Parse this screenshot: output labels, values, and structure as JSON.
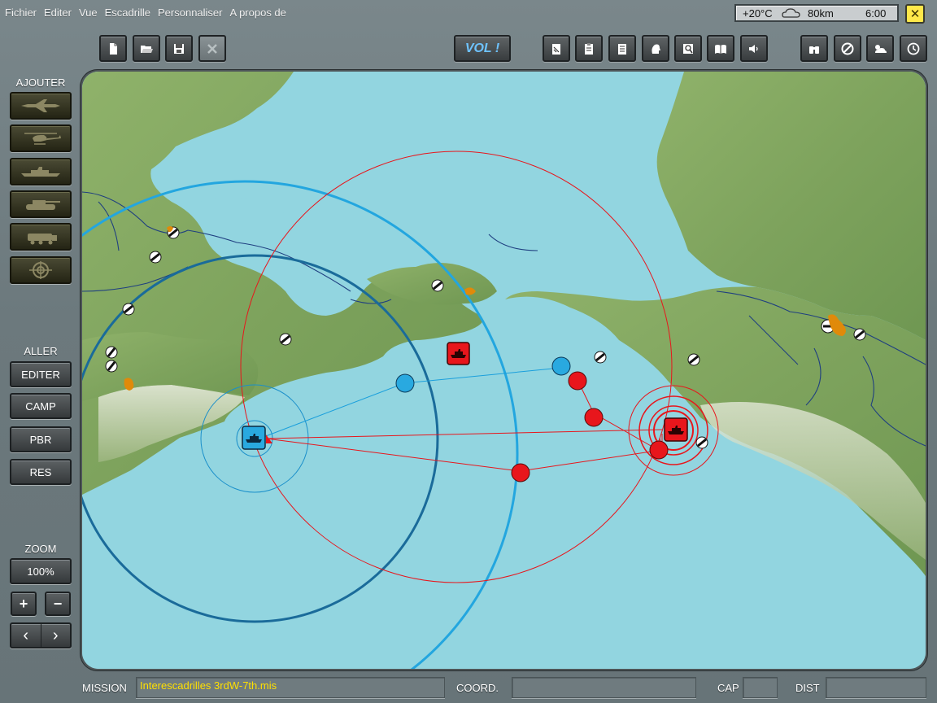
{
  "menu": {
    "items": [
      "Fichier",
      "Editer",
      "Vue",
      "Escadrille",
      "Personnaliser",
      "A propos de"
    ]
  },
  "status": {
    "temperature": "+20°C",
    "visibility": "80km",
    "time": "6:00",
    "weather_icon": "cloud-icon"
  },
  "close_label": "✕",
  "toolbar": {
    "vol_label": "VOL !",
    "file_buttons": [
      "new-file-icon",
      "open-folder-icon",
      "save-disk-icon",
      "close-x-icon"
    ],
    "mid_buttons": [
      "mission-clipboard-icon",
      "clipboard-icon",
      "checklist-icon",
      "pilot-head-icon",
      "magnify-doc-icon",
      "book-icon",
      "speaker-icon"
    ],
    "right_buttons": [
      "binoculars-icon",
      "no-entry-icon",
      "weather-icon",
      "clock-icon"
    ]
  },
  "sidebar": {
    "ajouter_label": "AJOUTER",
    "unit_buttons": [
      "jet-fighter-icon",
      "helicopter-icon",
      "warship-icon",
      "tank-icon",
      "truck-icon",
      "crosshair-target-icon"
    ],
    "aller_label": "ALLER",
    "aller_buttons": [
      "EDITER",
      "CAMP",
      "PBR",
      "RES"
    ],
    "zoom_label": "ZOOM",
    "zoom_value": "100%",
    "zoom_in_label": "+",
    "zoom_out_label": "−",
    "prev_label": "‹",
    "next_label": "›"
  },
  "bottom": {
    "mission_label": "MISSION",
    "mission_value": "Interescadrilles 3rdW-7th.mis",
    "coord_label": "COORD.",
    "coord_value": "",
    "cap_label": "CAP",
    "cap_value": "",
    "dist_label": "DIST",
    "dist_value": ""
  },
  "colors": {
    "sea": "#92d5e0",
    "land": "#7fa860",
    "blue_side": "#29a9e0",
    "red_side": "#e8161c",
    "accent_yellow": "#ffe000"
  }
}
